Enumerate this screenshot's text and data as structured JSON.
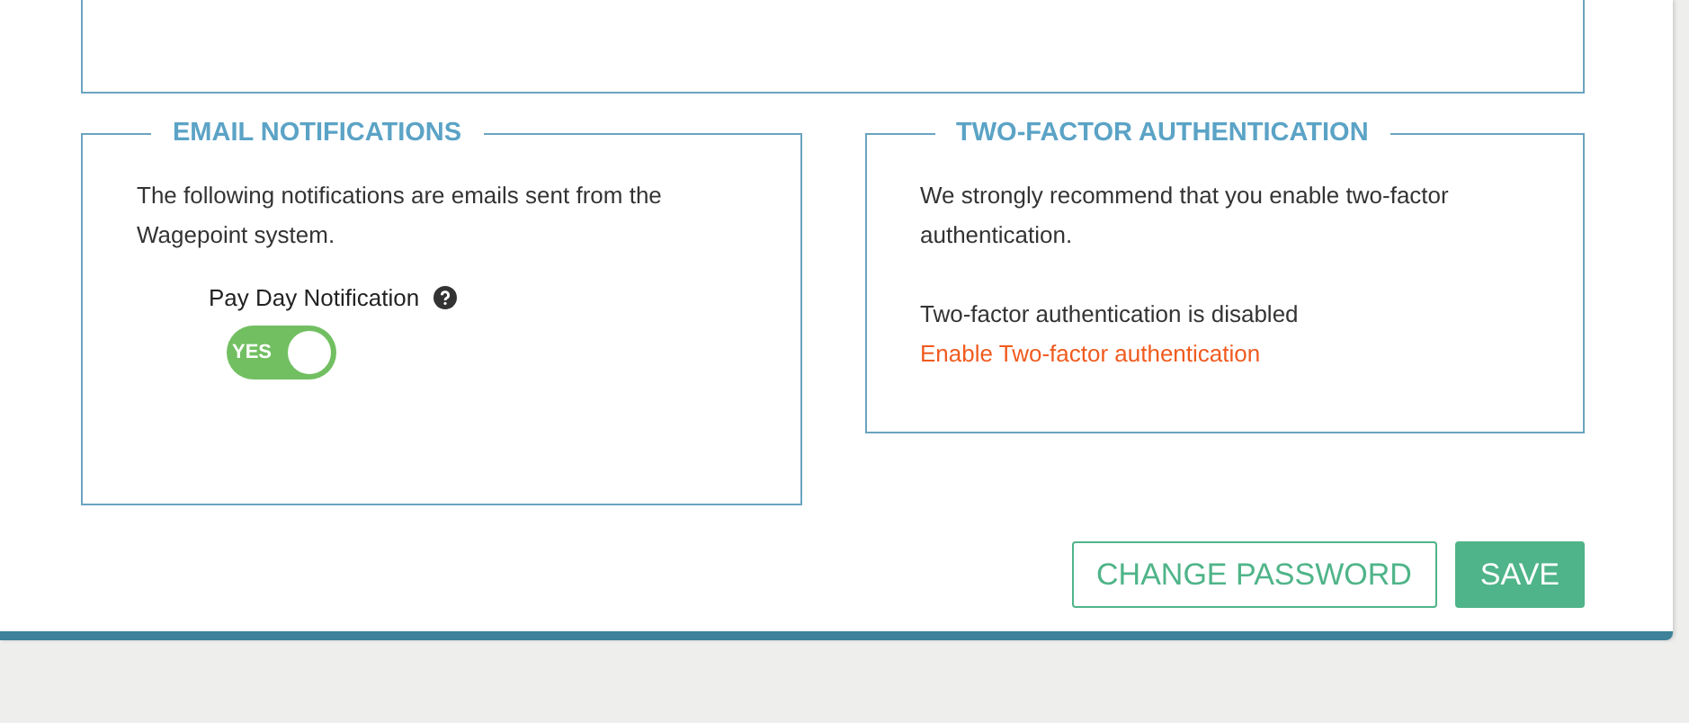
{
  "email_notifications": {
    "title": "EMAIL NOTIFICATIONS",
    "description": "The following notifications are emails sent from the Wagepoint system.",
    "settings": [
      {
        "label": "Pay Day Notification",
        "toggle_text": "YES",
        "on": true
      }
    ]
  },
  "two_factor": {
    "title": "TWO-FACTOR AUTHENTICATION",
    "description": "We strongly recommend that you enable two-factor authentication.",
    "status": "Two-factor authentication is disabled",
    "link": "Enable Two-factor authentication"
  },
  "buttons": [
    {
      "label": "CHANGE PASSWORD",
      "kind": "outline"
    },
    {
      "label": "SAVE",
      "kind": "primary"
    }
  ]
}
